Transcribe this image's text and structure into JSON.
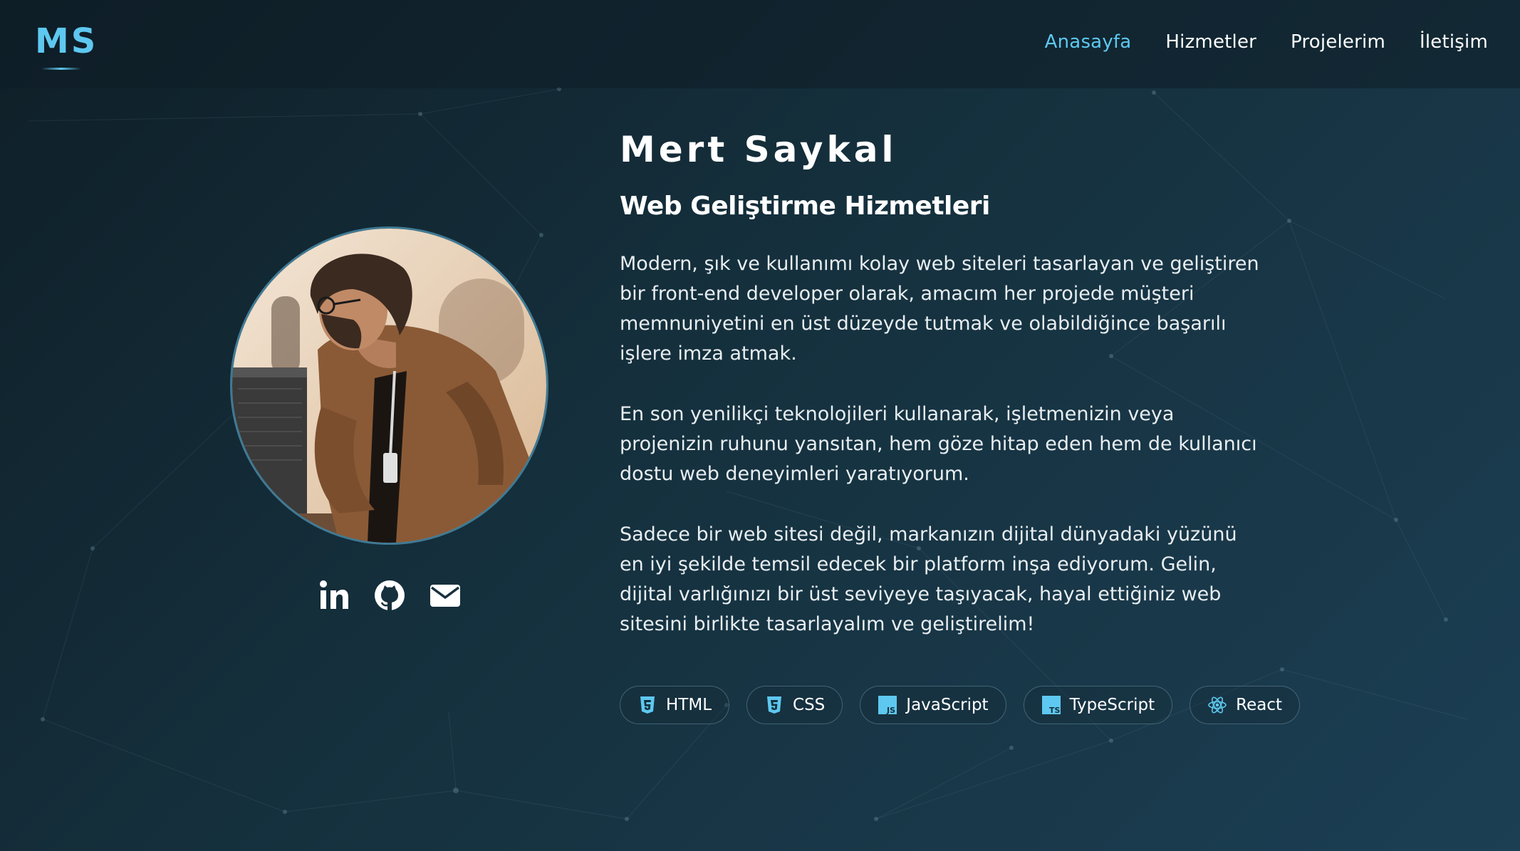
{
  "brand": {
    "logo": "MS"
  },
  "nav": {
    "items": [
      {
        "label": "Anasayfa",
        "active": true
      },
      {
        "label": "Hizmetler",
        "active": false
      },
      {
        "label": "Projelerim",
        "active": false
      },
      {
        "label": "İletişim",
        "active": false
      }
    ]
  },
  "hero": {
    "name": "Mert Saykal",
    "subtitle": "Web Geliştirme Hizmetleri",
    "paragraphs": [
      "Modern, şık ve kullanımı kolay web siteleri tasarlayan ve geliştiren bir front-end developer olarak, amacım her projede müşteri memnuniyetini en üst düzeyde tutmak ve olabildiğince başarılı işlere imza atmak.",
      "En son yenilikçi teknolojileri kullanarak, işletmenizin veya projenizin ruhunu yansıtan, hem göze hitap eden hem de kullanıcı dostu web deneyimleri yaratıyorum.",
      "Sadece bir web sitesi değil, markanızın dijital dünyadaki yüzünü en iyi şekilde temsil edecek bir platform inşa ediyorum. Gelin, dijital varlığınızı bir üst seviyeye taşıyacak, hayal ettiğiniz web sitesini birlikte tasarlayalım ve geliştirelim!"
    ]
  },
  "social": {
    "icons": [
      "linkedin-icon",
      "github-icon",
      "mail-icon"
    ]
  },
  "skills": [
    {
      "label": "HTML",
      "icon": "html5-icon"
    },
    {
      "label": "CSS",
      "icon": "css3-icon"
    },
    {
      "label": "JavaScript",
      "icon": "javascript-icon"
    },
    {
      "label": "TypeScript",
      "icon": "typescript-icon"
    },
    {
      "label": "React",
      "icon": "react-icon"
    }
  ],
  "colors": {
    "accent": "#5ec8f0",
    "background": "#15303d",
    "text": "#ffffff"
  }
}
